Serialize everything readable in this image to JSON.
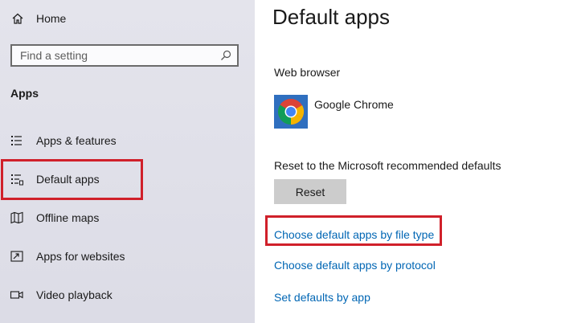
{
  "sidebar": {
    "home_label": "Home",
    "search": {
      "placeholder": "Find a setting",
      "value": ""
    },
    "section_title": "Apps",
    "items": [
      {
        "label": "Apps & features",
        "icon": "list-icon"
      },
      {
        "label": "Default apps",
        "icon": "default-apps-icon",
        "selected": true
      },
      {
        "label": "Offline maps",
        "icon": "map-icon"
      },
      {
        "label": "Apps for websites",
        "icon": "open-in-window-icon"
      },
      {
        "label": "Video playback",
        "icon": "video-icon"
      }
    ]
  },
  "main": {
    "title": "Default apps",
    "web_browser_label": "Web browser",
    "browser_name": "Google Chrome",
    "reset_label": "Reset to the Microsoft recommended defaults",
    "reset_button": "Reset",
    "links": [
      "Choose default apps by file type",
      "Choose default apps by protocol",
      "Set defaults by app"
    ]
  },
  "colors": {
    "accent_link": "#0066b4",
    "highlight": "#d0202a",
    "sidebar_bg": "#e0e0e8",
    "button_bg": "#cccccc"
  }
}
